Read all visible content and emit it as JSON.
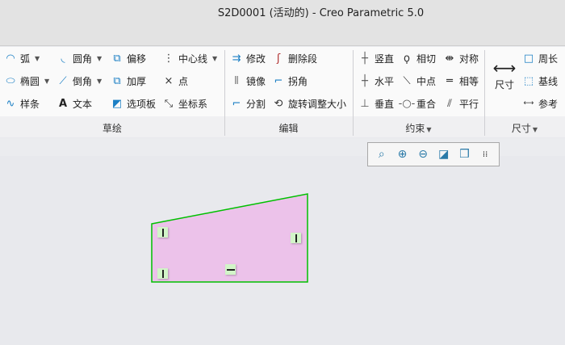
{
  "window": {
    "title": "S2D0001 (活动的) - Creo Parametric 5.0"
  },
  "ribbon": {
    "sketch": {
      "label": "草绘",
      "items": [
        {
          "label": "弧",
          "icon": "arc-icon",
          "dropdown": true
        },
        {
          "label": "椭圆",
          "icon": "ellipse-icon",
          "dropdown": true
        },
        {
          "label": "样条",
          "icon": "spline-icon"
        },
        {
          "label": "圆角",
          "icon": "fillet-icon",
          "dropdown": true
        },
        {
          "label": "倒角",
          "icon": "chamfer-icon",
          "dropdown": true
        },
        {
          "label": "文本",
          "icon": "text-icon"
        },
        {
          "label": "偏移",
          "icon": "offset-icon"
        },
        {
          "label": "加厚",
          "icon": "thicken-icon"
        },
        {
          "label": "选项板",
          "icon": "palette-icon"
        },
        {
          "label": "中心线",
          "icon": "centerline-icon",
          "dropdown": true
        },
        {
          "label": "点",
          "icon": "point-icon"
        },
        {
          "label": "坐标系",
          "icon": "coordinate-system-icon"
        }
      ]
    },
    "edit": {
      "label": "编辑",
      "items": [
        {
          "label": "修改",
          "icon": "modify-icon"
        },
        {
          "label": "镜像",
          "icon": "mirror-icon"
        },
        {
          "label": "分割",
          "icon": "divide-icon"
        },
        {
          "label": "删除段",
          "icon": "delete-segment-icon"
        },
        {
          "label": "拐角",
          "icon": "corner-icon"
        },
        {
          "label": "旋转调整大小",
          "icon": "rotate-resize-icon"
        }
      ]
    },
    "constrain": {
      "label": "约束",
      "items": [
        {
          "label": "竖直",
          "icon": "vertical-icon"
        },
        {
          "label": "水平",
          "icon": "horizontal-icon"
        },
        {
          "label": "垂直",
          "icon": "perpendicular-icon"
        },
        {
          "label": "相切",
          "icon": "tangent-icon"
        },
        {
          "label": "中点",
          "icon": "midpoint-icon"
        },
        {
          "label": "重合",
          "icon": "coincident-icon"
        },
        {
          "label": "对称",
          "icon": "symmetric-icon"
        },
        {
          "label": "相等",
          "icon": "equal-icon"
        },
        {
          "label": "平行",
          "icon": "parallel-icon"
        }
      ]
    },
    "dimension": {
      "label": "尺寸",
      "items": [
        {
          "label": "尺寸",
          "icon": "dimension-icon"
        },
        {
          "label": "周长",
          "icon": "perimeter-icon"
        },
        {
          "label": "基线",
          "icon": "baseline-icon"
        },
        {
          "label": "参考",
          "icon": "reference-icon"
        }
      ]
    }
  },
  "view_toolbar": [
    "refit-icon",
    "zoom-in-icon",
    "zoom-out-icon",
    "repaint-icon",
    "display-style-icon",
    "sketcher-display-filter-icon"
  ],
  "colors": {
    "fill": "#ecc2ea",
    "outline": "#00c000",
    "constraint": "#d2f5c8"
  }
}
